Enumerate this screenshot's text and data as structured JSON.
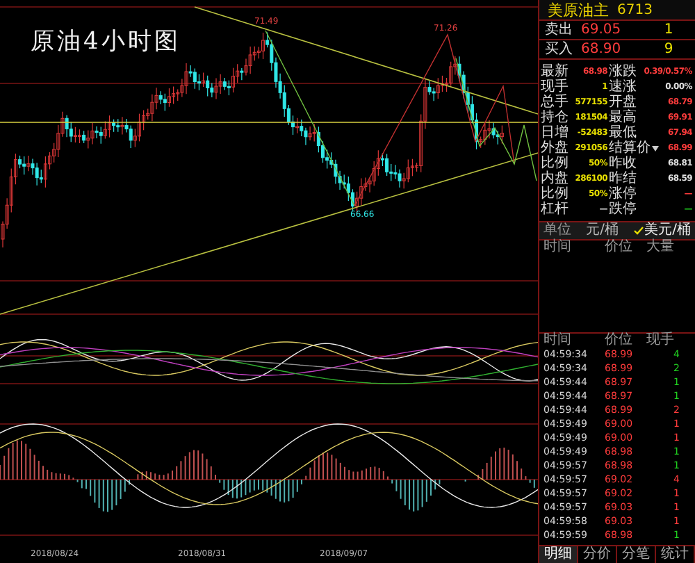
{
  "chart": {
    "title": "原油4小时图",
    "peak_labels": [
      {
        "text": "71.49",
        "kind": "high"
      },
      {
        "text": "71.26",
        "kind": "high"
      },
      {
        "text": "66.66",
        "kind": "low"
      }
    ],
    "dates": [
      "2018/08/24",
      "2018/08/31",
      "2018/09/07"
    ]
  },
  "quote": {
    "name": "美原油主",
    "code": "6713",
    "ask": {
      "label": "卖出",
      "price": "69.05",
      "size": "1"
    },
    "bid": {
      "label": "买入",
      "price": "68.90",
      "size": "9"
    },
    "stats": [
      {
        "left": {
          "label": "最新",
          "value": "68.98",
          "color": "#ff3c3c"
        },
        "right": {
          "label": "涨跌",
          "value": "0.39/0.57%",
          "color": "#ff3c3c"
        }
      },
      {
        "left": {
          "label": "现手",
          "value": "1",
          "color": "#e8e000"
        },
        "right": {
          "label": "速涨",
          "value": "0.00%",
          "color": "#e0e0e0"
        }
      },
      {
        "left": {
          "label": "总手",
          "value": "577155",
          "color": "#e8e000"
        },
        "right": {
          "label": "开盘",
          "value": "68.79",
          "color": "#ff3c3c"
        }
      },
      {
        "left": {
          "label": "持仓",
          "value": "181504",
          "color": "#e8e000"
        },
        "right": {
          "label": "最高",
          "value": "69.91",
          "color": "#ff3c3c"
        }
      },
      {
        "left": {
          "label": "日增",
          "value": "-52483",
          "color": "#e8e000"
        },
        "right": {
          "label": "最低",
          "value": "67.94",
          "color": "#ff3c3c"
        }
      },
      {
        "left": {
          "label": "外盘",
          "value": "291056",
          "color": "#e8e000"
        },
        "right": {
          "label": "结算价",
          "value": "68.99",
          "color": "#ff3c3c",
          "dropdown": true
        }
      },
      {
        "left": {
          "label": "比例",
          "value": "50%",
          "color": "#e8e000"
        },
        "right": {
          "label": "昨收",
          "value": "68.81",
          "color": "#e0e0e0"
        }
      },
      {
        "left": {
          "label": "内盘",
          "value": "286100",
          "color": "#e8e000"
        },
        "right": {
          "label": "昨结",
          "value": "68.59",
          "color": "#e0e0e0"
        }
      },
      {
        "left": {
          "label": "比例",
          "value": "50%",
          "color": "#e8e000"
        },
        "right": {
          "label": "涨停",
          "value": "—",
          "color": "#ff3c3c"
        }
      },
      {
        "left": {
          "label": "杠杆",
          "value": "—",
          "color": "#e0e0e0"
        },
        "right": {
          "label": "跌停",
          "value": "—",
          "color": "#20d020"
        }
      }
    ]
  },
  "unit": {
    "label": "单位",
    "options": [
      {
        "label": "元/桶",
        "selected": false
      },
      {
        "label": "美元/桶",
        "selected": true
      }
    ]
  },
  "big_trades": {
    "columns": [
      "时间",
      "价位",
      "大量"
    ]
  },
  "ticks": {
    "columns": [
      "时间",
      "价位",
      "现手"
    ],
    "rows": [
      {
        "time": "04:59:34",
        "price": "68.99",
        "volume": "4",
        "color": "#20d020"
      },
      {
        "time": "04:59:34",
        "price": "68.99",
        "volume": "2",
        "color": "#20d020"
      },
      {
        "time": "04:59:44",
        "price": "68.97",
        "volume": "1",
        "color": "#20d020"
      },
      {
        "time": "04:59:44",
        "price": "68.97",
        "volume": "1",
        "color": "#20d020"
      },
      {
        "time": "04:59:44",
        "price": "68.99",
        "volume": "2",
        "color": "#ff3c3c"
      },
      {
        "time": "04:59:49",
        "price": "69.00",
        "volume": "1",
        "color": "#ff3c3c"
      },
      {
        "time": "04:59:49",
        "price": "69.00",
        "volume": "1",
        "color": "#ff3c3c"
      },
      {
        "time": "04:59:49",
        "price": "68.98",
        "volume": "1",
        "color": "#20d020"
      },
      {
        "time": "04:59:57",
        "price": "68.98",
        "volume": "1",
        "color": "#20d020"
      },
      {
        "time": "04:59:57",
        "price": "69.02",
        "volume": "4",
        "color": "#ff3c3c"
      },
      {
        "time": "04:59:57",
        "price": "69.02",
        "volume": "1",
        "color": "#ff3c3c"
      },
      {
        "time": "04:59:57",
        "price": "69.03",
        "volume": "1",
        "color": "#ff3c3c"
      },
      {
        "time": "04:59:58",
        "price": "69.03",
        "volume": "1",
        "color": "#ff3c3c"
      },
      {
        "time": "04:59:59",
        "price": "68.98",
        "volume": "1",
        "color": "#20d020"
      }
    ]
  },
  "tabs": [
    {
      "label": "明细",
      "selected": true
    },
    {
      "label": "分价",
      "selected": false
    },
    {
      "label": "分笔",
      "selected": false
    },
    {
      "label": "统计",
      "selected": false
    }
  ]
}
